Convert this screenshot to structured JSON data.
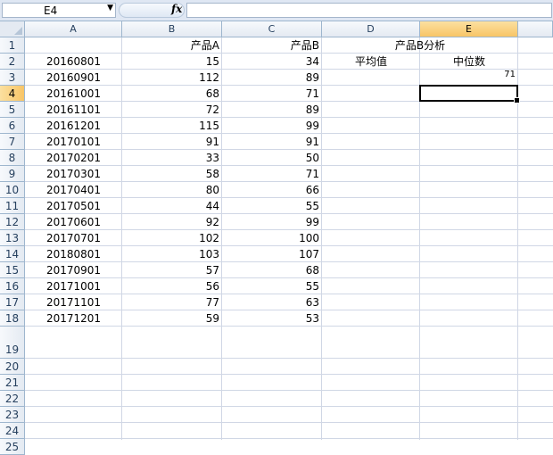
{
  "name_box": {
    "value": "E4"
  },
  "formula": {
    "value": ""
  },
  "columns": [
    "A",
    "B",
    "C",
    "D",
    "E"
  ],
  "active_col": "E",
  "active_row": 4,
  "rows": [
    "1",
    "2",
    "3",
    "4",
    "5",
    "6",
    "7",
    "8",
    "9",
    "10",
    "11",
    "12",
    "13",
    "14",
    "15",
    "16",
    "17",
    "18",
    "19",
    "20",
    "21",
    "22",
    "23",
    "24",
    "25"
  ],
  "header_row": {
    "B": "产品A",
    "C": "产品B",
    "DE": "产品B分析"
  },
  "analysis": {
    "d2": "平均值",
    "e2": "中位数",
    "e3": "71"
  },
  "data": [
    {
      "a": "20160801",
      "b": "15",
      "c": "34"
    },
    {
      "a": "20160901",
      "b": "112",
      "c": "89"
    },
    {
      "a": "20161001",
      "b": "68",
      "c": "71"
    },
    {
      "a": "20161101",
      "b": "72",
      "c": "89"
    },
    {
      "a": "20161201",
      "b": "115",
      "c": "99"
    },
    {
      "a": "20170101",
      "b": "91",
      "c": "91"
    },
    {
      "a": "20170201",
      "b": "33",
      "c": "50"
    },
    {
      "a": "20170301",
      "b": "58",
      "c": "71"
    },
    {
      "a": "20170401",
      "b": "80",
      "c": "66"
    },
    {
      "a": "20170501",
      "b": "44",
      "c": "55"
    },
    {
      "a": "20170601",
      "b": "92",
      "c": "99"
    },
    {
      "a": "20170701",
      "b": "102",
      "c": "100"
    },
    {
      "a": "20180801",
      "b": "103",
      "c": "107"
    },
    {
      "a": "20170901",
      "b": "57",
      "c": "68"
    },
    {
      "a": "20171001",
      "b": "56",
      "c": "55"
    },
    {
      "a": "20171101",
      "b": "77",
      "c": "63"
    },
    {
      "a": "20171201",
      "b": "59",
      "c": "53"
    }
  ]
}
